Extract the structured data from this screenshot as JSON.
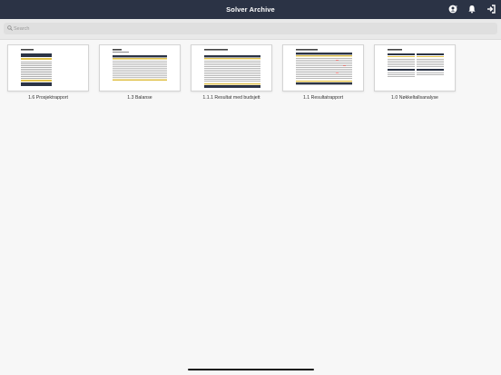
{
  "header": {
    "title": "Solver Archive",
    "icons": [
      "user-sync-icon",
      "bell-icon",
      "sign-in-icon"
    ],
    "bar_color": "#2b3345"
  },
  "search": {
    "placeholder": "Search",
    "value": ""
  },
  "documents": [
    {
      "label": "1.6 Prosjektrapport",
      "icon": "report-thumbnail"
    },
    {
      "label": "1.3 Balanse",
      "icon": "report-thumbnail"
    },
    {
      "label": "1.1.1 Resultat med budsjett",
      "icon": "report-thumbnail"
    },
    {
      "label": "1.1 Resultatrapport",
      "icon": "report-thumbnail"
    },
    {
      "label": "1.0 Nøkkeltallsanalyse",
      "icon": "report-thumbnail"
    }
  ]
}
